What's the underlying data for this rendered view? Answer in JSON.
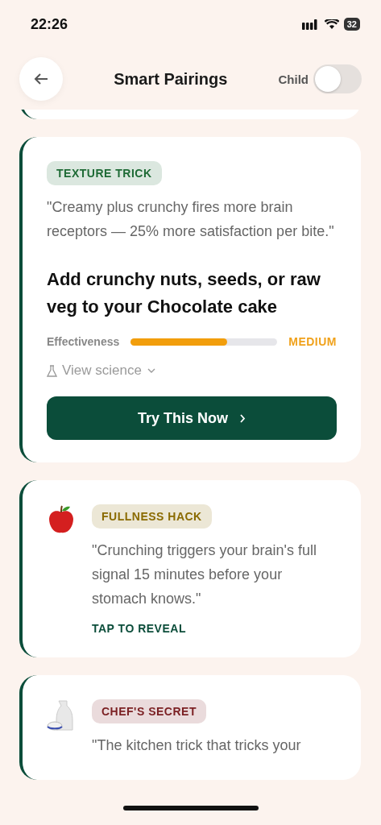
{
  "status_bar": {
    "time": "22:26",
    "battery": "32"
  },
  "header": {
    "title": "Smart Pairings",
    "toggle": {
      "label": "Child",
      "on": false
    }
  },
  "cards": [
    {
      "kind": "featured",
      "tag": "TEXTURE TRICK",
      "color": "#1f6b36",
      "quote": "\"Creamy plus crunchy fires more brain receptors — 25% more satisfaction per bite.\"",
      "headline": "Add crunchy nuts, seeds, or raw veg to your Chocolate cake",
      "effectiveness": {
        "label": "Effectiveness",
        "level": 0.66,
        "rating": "MEDIUM"
      },
      "science_link": "View science",
      "button": "Try This Now"
    },
    {
      "kind": "reveal",
      "tag": "FULLNESS HACK",
      "color": "#8a6a00",
      "quote": "\"Crunching triggers your brain's full signal 15 minutes before your stomach knows.\"",
      "action": "TAP TO REVEAL"
    },
    {
      "kind": "reveal",
      "tag": "CHEF'S SECRET",
      "color": "#7a1f22",
      "quote": "\"The kitchen trick that tricks your"
    }
  ]
}
